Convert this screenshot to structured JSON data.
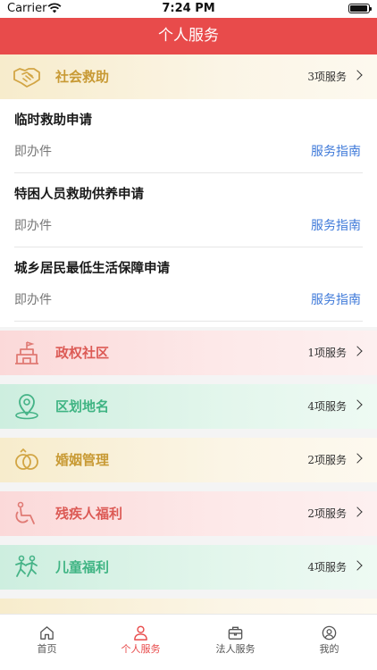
{
  "status_bar": {
    "carrier": "Carrier",
    "time": "7:24 PM"
  },
  "header": {
    "title": "个人服务"
  },
  "sections": [
    {
      "title": "社会救助",
      "count": "3项服务",
      "theme": "yellow",
      "icon": "handshake-icon",
      "items": [
        {
          "title": "临时救助申请",
          "type": "即办件",
          "guide": "服务指南"
        },
        {
          "title": "特困人员救助供养申请",
          "type": "即办件",
          "guide": "服务指南"
        },
        {
          "title": "城乡居民最低生活保障申请",
          "type": "即办件",
          "guide": "服务指南"
        }
      ]
    },
    {
      "title": "政权社区",
      "count": "1项服务",
      "theme": "red",
      "icon": "government-building-icon"
    },
    {
      "title": "区划地名",
      "count": "4项服务",
      "theme": "green",
      "icon": "map-pin-icon"
    },
    {
      "title": "婚姻管理",
      "count": "2项服务",
      "theme": "yellow",
      "icon": "interlocked-rings-icon"
    },
    {
      "title": "残疾人福利",
      "count": "2项服务",
      "theme": "red",
      "icon": "wheelchair-icon"
    },
    {
      "title": "儿童福利",
      "count": "4项服务",
      "theme": "green",
      "icon": "children-running-icon"
    }
  ],
  "tabbar": {
    "tabs": [
      {
        "label": "首页",
        "icon": "home-icon"
      },
      {
        "label": "个人服务",
        "icon": "person-icon",
        "active": true
      },
      {
        "label": "法人服务",
        "icon": "briefcase-icon"
      },
      {
        "label": "我的",
        "icon": "user-circle-icon"
      }
    ]
  }
}
